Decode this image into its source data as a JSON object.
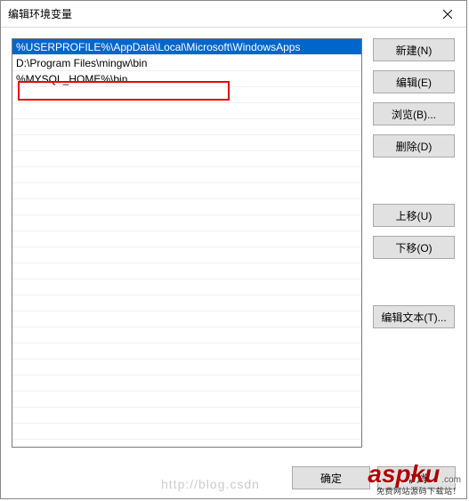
{
  "title": "编辑环境变量",
  "list": {
    "items": [
      "%USERPROFILE%\\AppData\\Local\\Microsoft\\WindowsApps",
      "D:\\Program Files\\mingw\\bin",
      "%MYSQL_HOME%\\bin"
    ],
    "selected_index": 0,
    "highlighted_index": 2
  },
  "buttons": {
    "new": "新建(N)",
    "edit": "编辑(E)",
    "browse": "浏览(B)...",
    "delete": "删除(D)",
    "move_up": "上移(U)",
    "move_down": "下移(O)",
    "edit_text": "编辑文本(T)...",
    "ok": "确定",
    "cancel": "取消"
  },
  "watermark": {
    "logo": "aspku",
    "logo_suffix": ".com",
    "sub": "免费网站源码下载站！",
    "url": "http://blog.csdn"
  }
}
